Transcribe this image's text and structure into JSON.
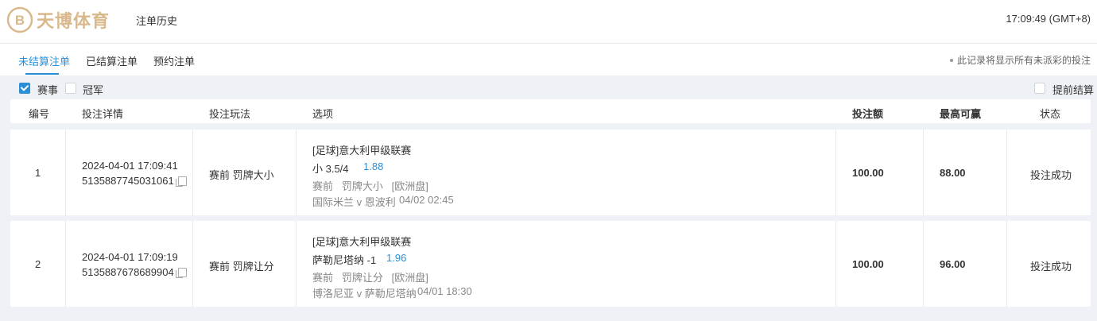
{
  "header": {
    "logo_text": "天博体育",
    "nav_history": "注单历史",
    "clock": "17:09:49 (GMT+8)"
  },
  "tabs": [
    {
      "label": "未结算注单",
      "active": true
    },
    {
      "label": "已结算注单",
      "active": false
    },
    {
      "label": "预约注单",
      "active": false
    }
  ],
  "note": "此记录将显示所有未派彩的投注",
  "filters": {
    "event": {
      "label": "赛事",
      "checked": true
    },
    "champion": {
      "label": "冠军",
      "checked": false
    },
    "early_settle": {
      "label": "提前结算",
      "checked": false
    }
  },
  "columns": {
    "id": "编号",
    "detail": "投注详情",
    "play": "投注玩法",
    "option": "选项",
    "stake": "投注额",
    "max_win": "最高可赢",
    "status": "状态"
  },
  "bets": [
    {
      "no": "1",
      "datetime": "2024-04-01 17:09:41",
      "ticket": "5135887745031061",
      "play": "赛前 罚牌大小",
      "league": "[足球]意大利甲级联赛",
      "pick": "小 3.5/4",
      "odds": "1.88",
      "market": "赛前   罚牌大小   [欧洲盘]",
      "match": "国际米兰 v 恩波利",
      "match_time": "04/02 02:45",
      "stake": "100.00",
      "max_win": "88.00",
      "status": "投注成功"
    },
    {
      "no": "2",
      "datetime": "2024-04-01 17:09:19",
      "ticket": "5135887678689904",
      "play": "赛前 罚牌让分",
      "league": "[足球]意大利甲级联赛",
      "pick": "萨勒尼塔纳 -1",
      "odds": "1.96",
      "market": "赛前   罚牌让分   [欧洲盘]",
      "match": "博洛尼亚 v 萨勒尼塔纳",
      "match_time": "04/01 18:30",
      "stake": "100.00",
      "max_win": "96.00",
      "status": "投注成功"
    }
  ],
  "colors": {
    "accent": "#2a8fd6",
    "logo": "#d9b98c",
    "background": "#eef1f5"
  }
}
